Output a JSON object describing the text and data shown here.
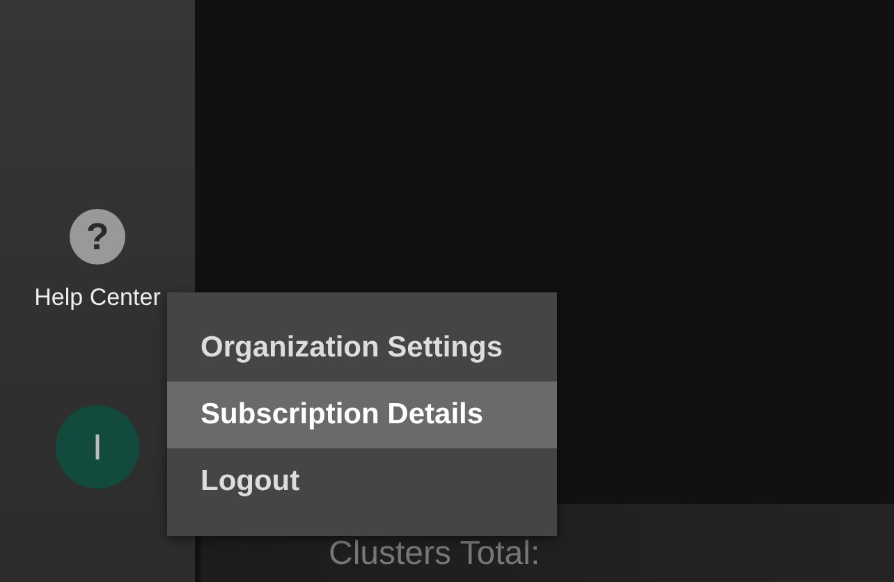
{
  "sidebar": {
    "items": [
      {
        "kind": "help",
        "icon": "?",
        "label": "Help Center"
      },
      {
        "kind": "avatar",
        "initial": "I"
      }
    ]
  },
  "user_menu": {
    "items": [
      {
        "label": "Organization Settings",
        "selected": false
      },
      {
        "label": "Subscription Details",
        "selected": true
      },
      {
        "label": "Logout",
        "selected": false
      }
    ]
  },
  "summary": {
    "label": "Clusters Total:"
  }
}
